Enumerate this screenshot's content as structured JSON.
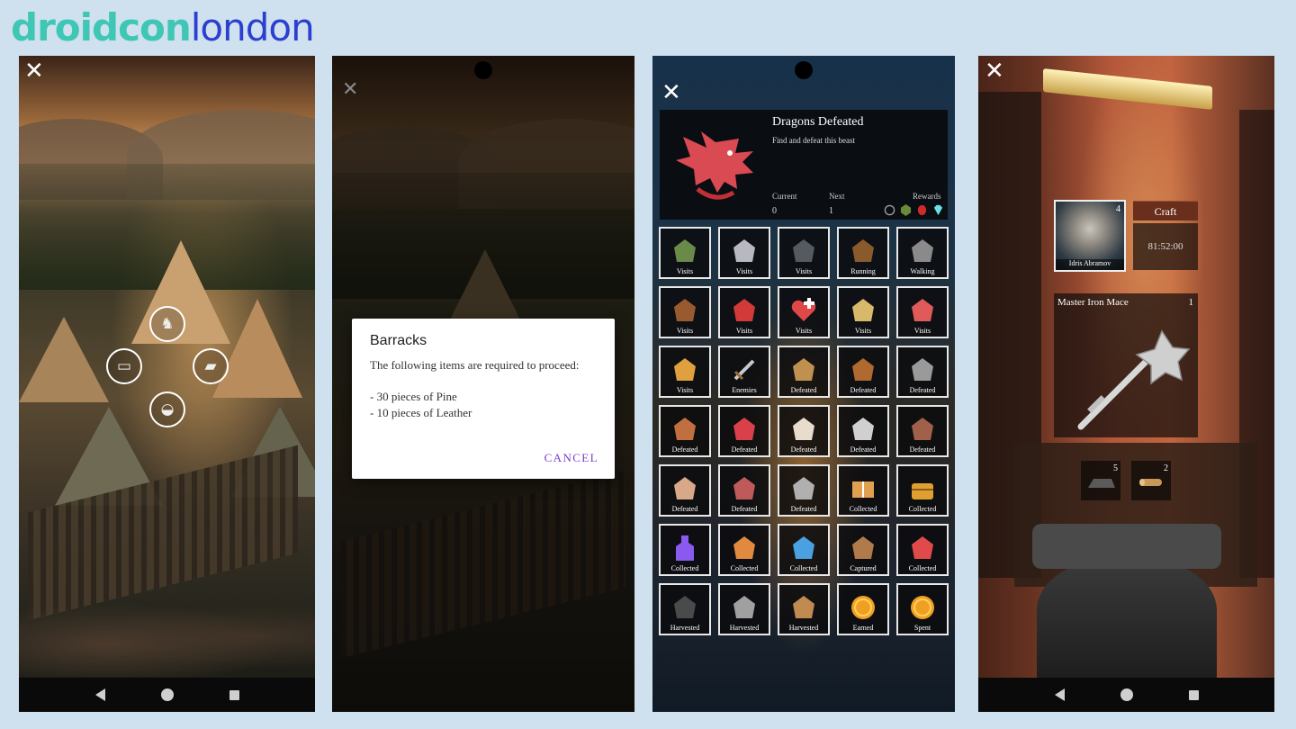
{
  "logo": {
    "part1": "droidcon",
    "part2": "london"
  },
  "screen1": {
    "close_glyph": "✕",
    "markers": [
      {
        "name": "marker-knight",
        "icon": "knight-icon",
        "glyph": "♞"
      },
      {
        "name": "marker-chest",
        "icon": "chest-icon",
        "glyph": "▭"
      },
      {
        "name": "marker-anvil",
        "icon": "anvil-icon",
        "glyph": "▰"
      },
      {
        "name": "marker-cauldron",
        "icon": "cauldron-icon",
        "glyph": "◒"
      }
    ]
  },
  "screen2": {
    "close_glyph": "✕",
    "dialog": {
      "title": "Barracks",
      "message": "The following items are required to proceed:",
      "items": [
        "- 30 pieces of Pine",
        "- 10 pieces of Leather"
      ],
      "cancel": "CANCEL"
    }
  },
  "screen3": {
    "close_glyph": "✕",
    "achievement": {
      "title": "Dragons Defeated",
      "subtitle": "Find and defeat this beast",
      "current_label": "Current",
      "current_value": "0",
      "next_label": "Next",
      "next_value": "1",
      "rewards_label": "Rewards",
      "reward_icons": [
        "empty-ring-icon",
        "green-gem-icon",
        "red-gem-icon",
        "diamond-icon"
      ]
    },
    "tiles": [
      {
        "icon": "cauldron-icon",
        "label": "Visits",
        "color": "#6a8a4a"
      },
      {
        "icon": "knight-icon",
        "label": "Visits",
        "color": "#b8b8c0"
      },
      {
        "icon": "anvil-icon",
        "label": "Visits",
        "color": "#555a60"
      },
      {
        "icon": "boot-icon",
        "label": "Running",
        "color": "#8a5a2c"
      },
      {
        "icon": "boot-icon",
        "label": "Walking",
        "color": "#8a8a8a"
      },
      {
        "icon": "shield-icon",
        "label": "Visits",
        "color": "#9a5a30"
      },
      {
        "icon": "barn-icon",
        "label": "Visits",
        "color": "#d23a3a"
      },
      {
        "icon": "heart-plus-icon",
        "label": "Visits",
        "color": "#e04848"
      },
      {
        "icon": "map-icon",
        "label": "Visits",
        "color": "#d8b86a"
      },
      {
        "icon": "market-stall-icon",
        "label": "Visits",
        "color": "#e05a5a"
      },
      {
        "icon": "scarecrow-icon",
        "label": "Visits",
        "color": "#e0a040"
      },
      {
        "icon": "sword-icon",
        "label": "Enemies",
        "color": "#c8c8d0"
      },
      {
        "icon": "viking-helmet-icon",
        "label": "Defeated",
        "color": "#c09050"
      },
      {
        "icon": "lizard-icon",
        "label": "Defeated",
        "color": "#b06a30"
      },
      {
        "icon": "wolf-icon",
        "label": "Defeated",
        "color": "#9a9a9a"
      },
      {
        "icon": "serpent-icon",
        "label": "Defeated",
        "color": "#c07040"
      },
      {
        "icon": "dragon-icon",
        "label": "Defeated",
        "color": "#d8404a"
      },
      {
        "icon": "griffin-icon",
        "label": "Defeated",
        "color": "#e8dccc"
      },
      {
        "icon": "snake-icon",
        "label": "Defeated",
        "color": "#d0d0d0"
      },
      {
        "icon": "minotaur-icon",
        "label": "Defeated",
        "color": "#a0604a"
      },
      {
        "icon": "ogre-icon",
        "label": "Defeated",
        "color": "#d8a888"
      },
      {
        "icon": "wizard-icon",
        "label": "Defeated",
        "color": "#c05a5a"
      },
      {
        "icon": "wolf-icon",
        "label": "Defeated",
        "color": "#b0b0b0"
      },
      {
        "icon": "book-icon",
        "label": "Collected",
        "color": "#e0a050"
      },
      {
        "icon": "treasure-chest-icon",
        "label": "Collected",
        "color": "#e0a030"
      },
      {
        "icon": "potion-icon",
        "label": "Collected",
        "color": "#8a5af0"
      },
      {
        "icon": "mushroom-icon",
        "label": "Collected",
        "color": "#e08a40"
      },
      {
        "icon": "bird-icon",
        "label": "Collected",
        "color": "#4aa0e0"
      },
      {
        "icon": "horse-icon",
        "label": "Captured",
        "color": "#b07a4a"
      },
      {
        "icon": "flower-icon",
        "label": "Collected",
        "color": "#e04a4a"
      },
      {
        "icon": "coal-icon",
        "label": "Harvested",
        "color": "#4a4a4a"
      },
      {
        "icon": "stone-icon",
        "label": "Harvested",
        "color": "#a0a0a0"
      },
      {
        "icon": "logs-icon",
        "label": "Harvested",
        "color": "#c08a50"
      },
      {
        "icon": "coin-icon",
        "label": "Earned",
        "color": "#f0a020"
      },
      {
        "icon": "coin-icon",
        "label": "Spent",
        "color": "#f0a020"
      }
    ]
  },
  "screen4": {
    "close_glyph": "✕",
    "character": {
      "name": "Idris Abramov",
      "count": "4"
    },
    "craft_label": "Craft",
    "timer": "81:52:00",
    "item": {
      "name": "Master Iron Mace",
      "quantity": "1"
    },
    "requirements": [
      {
        "icon": "iron-ingot-icon",
        "quantity": "5"
      },
      {
        "icon": "log-icon",
        "quantity": "2"
      }
    ]
  }
}
